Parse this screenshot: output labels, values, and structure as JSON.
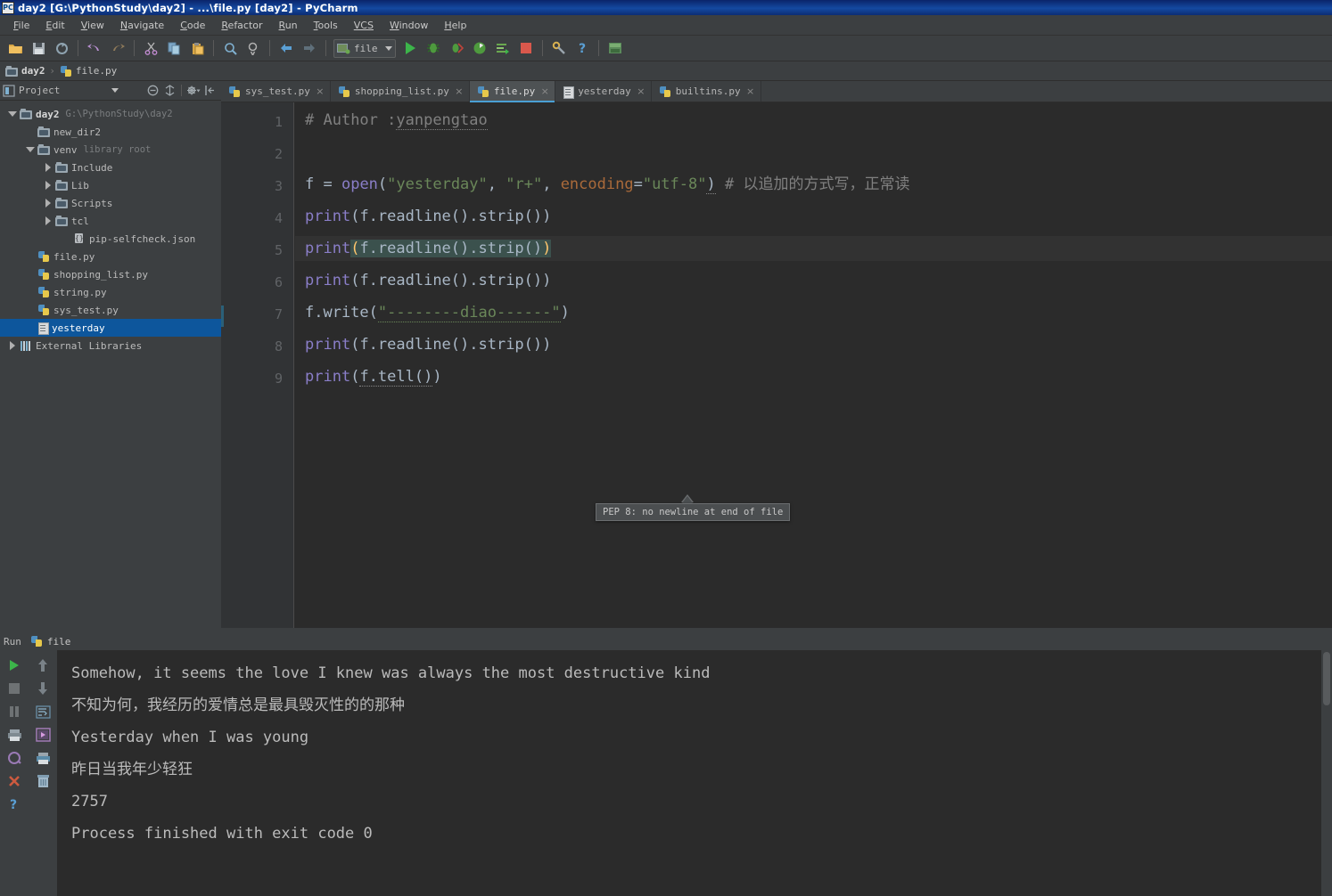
{
  "window": {
    "title": "day2 [G:\\PythonStudy\\day2] - ...\\file.py [day2] - PyCharm",
    "app_icon": "PC"
  },
  "menubar": {
    "items": [
      {
        "pre": "F",
        "rest": "ile"
      },
      {
        "pre": "E",
        "rest": "dit"
      },
      {
        "pre": "V",
        "rest": "iew"
      },
      {
        "pre": "N",
        "rest": "avigate"
      },
      {
        "pre": "C",
        "rest": "ode"
      },
      {
        "pre": "R",
        "rest": "efactor"
      },
      {
        "pre": "R",
        "rest": "un"
      },
      {
        "pre": "T",
        "rest": "ools"
      },
      {
        "pre": "VCS",
        "rest": ""
      },
      {
        "pre": "W",
        "rest": "indow"
      },
      {
        "pre": "H",
        "rest": "elp"
      }
    ]
  },
  "toolbar": {
    "run_config_label": "file",
    "buttons": [
      "open-icon",
      "save-all-icon",
      "sync-icon",
      "undo-icon",
      "redo-icon",
      "cut-icon",
      "copy-icon",
      "paste-icon",
      "find-icon",
      "find-replace-icon",
      "back-icon",
      "forward-icon",
      "run-icon",
      "debug-icon",
      "run-coverage-icon",
      "profile-icon",
      "run-with-console-icon",
      "stop-icon",
      "settings-icon",
      "help-icon",
      "python-console-icon"
    ]
  },
  "breadcrumb": {
    "items": [
      {
        "label": "day2",
        "icon": "folder-icon",
        "bold": true
      },
      {
        "label": "file.py",
        "icon": "python-file-icon",
        "bold": false
      }
    ],
    "separator": "›"
  },
  "project_panel": {
    "title": "Project",
    "tools": [
      "collapse-all-icon",
      "scroll-from-source-icon",
      "settings-gear-icon",
      "hide-icon"
    ],
    "tree": [
      {
        "depth": 0,
        "twisty": "down",
        "icon": "folder-icon",
        "label": "day2",
        "bold": true,
        "sub": "G:\\PythonStudy\\day2",
        "selected": false
      },
      {
        "depth": 1,
        "twisty": "none",
        "icon": "folder-icon",
        "label": "new_dir2",
        "bold": false,
        "sub": "",
        "selected": false
      },
      {
        "depth": 1,
        "twisty": "down",
        "icon": "folder-icon",
        "label": "venv",
        "bold": false,
        "sub": "library root",
        "selected": false
      },
      {
        "depth": 2,
        "twisty": "right",
        "icon": "folder-icon",
        "label": "Include",
        "bold": false,
        "sub": "",
        "selected": false
      },
      {
        "depth": 2,
        "twisty": "right",
        "icon": "folder-icon",
        "label": "Lib",
        "bold": false,
        "sub": "",
        "selected": false
      },
      {
        "depth": 2,
        "twisty": "right",
        "icon": "folder-icon",
        "label": "Scripts",
        "bold": false,
        "sub": "",
        "selected": false
      },
      {
        "depth": 2,
        "twisty": "right",
        "icon": "folder-icon",
        "label": "tcl",
        "bold": false,
        "sub": "",
        "selected": false
      },
      {
        "depth": 3,
        "twisty": "none",
        "icon": "json-file-icon",
        "label": "pip-selfcheck.json",
        "bold": false,
        "sub": "",
        "selected": false
      },
      {
        "depth": 1,
        "twisty": "none",
        "icon": "python-file-icon",
        "label": "file.py",
        "bold": false,
        "sub": "",
        "selected": false
      },
      {
        "depth": 1,
        "twisty": "none",
        "icon": "python-file-icon",
        "label": "shopping_list.py",
        "bold": false,
        "sub": "",
        "selected": false
      },
      {
        "depth": 1,
        "twisty": "none",
        "icon": "python-file-icon",
        "label": "string.py",
        "bold": false,
        "sub": "",
        "selected": false
      },
      {
        "depth": 1,
        "twisty": "none",
        "icon": "python-file-icon",
        "label": "sys_test.py",
        "bold": false,
        "sub": "",
        "selected": false
      },
      {
        "depth": 1,
        "twisty": "none",
        "icon": "text-file-icon",
        "label": "yesterday",
        "bold": false,
        "sub": "",
        "selected": true
      },
      {
        "depth": 0,
        "twisty": "right",
        "icon": "libraries-icon",
        "label": "External Libraries",
        "bold": false,
        "sub": "",
        "selected": false
      }
    ]
  },
  "editor_tabs": [
    {
      "label": "sys_test.py",
      "icon": "python-file-icon",
      "active": false,
      "close": "×"
    },
    {
      "label": "shopping_list.py",
      "icon": "python-file-icon",
      "active": false,
      "close": "×"
    },
    {
      "label": "file.py",
      "icon": "python-file-icon",
      "active": true,
      "close": "×"
    },
    {
      "label": "yesterday",
      "icon": "text-file-icon",
      "active": false,
      "close": "×"
    },
    {
      "label": "builtins.py",
      "icon": "python-file-icon",
      "active": false,
      "close": "×"
    }
  ],
  "editor": {
    "line_numbers": [
      "1",
      "2",
      "3",
      "4",
      "5",
      "6",
      "7",
      "8",
      "9"
    ],
    "lines": [
      "# Author :yanpengtao",
      "",
      "f = open(\"yesterday\", \"r+\", encoding=\"utf-8\") # 以追加的方式写，正常读",
      "print(f.readline().strip())",
      "print(f.readline().strip())",
      "print(f.readline().strip())",
      "f.write(\"--------diao------\")",
      "print(f.readline().strip())",
      "print(f.tell())"
    ],
    "tokens": {
      "comment_hash": "#",
      "author_text": " Author :",
      "author_name": "yanpengtao",
      "var_f": "f",
      "eq": " = ",
      "fn_open": "open",
      "paren_open": "(",
      "str_yesterday": "\"yesterday\"",
      "comma1": ", ",
      "str_rplus": "\"r+\"",
      "comma2": ", ",
      "param_encoding": "encoding",
      "assign": "=",
      "str_utf8": "\"utf-8\"",
      "paren_close": ")",
      "trailing_comment": " # 以追加的方式写，正常读",
      "fn_print": "print",
      "expr_readline": "f.readline().strip()",
      "fn_write_obj": "f.write",
      "str_diao": "\"--------diao------\"",
      "expr_tell": "f.tell()"
    },
    "tooltip": "PEP 8: no newline at end of file"
  },
  "run_panel": {
    "tab_label": "Run",
    "tab_name": "file",
    "left_buttons": [
      "rerun-icon",
      "stop-icon",
      "pause-icon",
      "print-icon",
      "soft-wrap-icon",
      "close-icon",
      "help-icon"
    ],
    "right_buttons": [
      "scroll-up-icon",
      "scroll-down-icon",
      "use-soft-wraps-icon",
      "scroll-to-end-icon",
      "print-output-icon",
      "clear-all-icon"
    ],
    "console_lines": [
      "Somehow, it seems the love I knew was always the most destructive kind",
      "不知为何，我经历的爱情总是最具毁灭性的的那种",
      "Yesterday when I was young",
      "昨日当我年少轻狂",
      "2757",
      "",
      "Process finished with exit code 0"
    ]
  },
  "colors": {
    "titlebar": "#0a246a",
    "chrome": "#3c3f41",
    "editor_bg": "#2b2b2b",
    "gutter_bg": "#313335",
    "selection": "#0d569c",
    "tab_accent": "#4a9fd4",
    "string": "#6a8759",
    "keyword": "#cc7832",
    "function": "#8a7ec8",
    "comment": "#808080",
    "bracket_match": "#ffc66d",
    "text": "#a9b7c6"
  }
}
